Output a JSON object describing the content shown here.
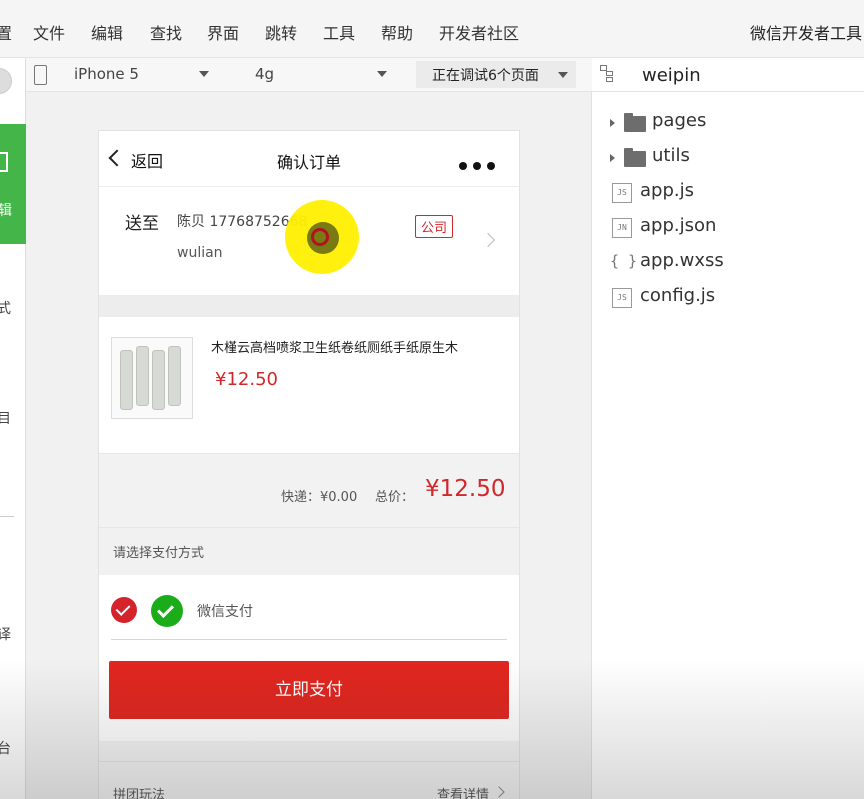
{
  "menubar": {
    "items": [
      "置",
      "文件",
      "编辑",
      "查找",
      "界面",
      "跳转",
      "工具",
      "帮助",
      "开发者社区"
    ],
    "app_title": "微信开发者工具"
  },
  "sidebar_strip": {
    "green_label": "辑",
    "texts": [
      "式",
      "目",
      "译",
      "台"
    ]
  },
  "device_bar": {
    "device": "iPhone 5",
    "network": "4g",
    "debug_status": "正在调试6个页面"
  },
  "phone": {
    "nav": {
      "back_label": "返回",
      "title": "确认订单"
    },
    "address": {
      "ship_to_label": "送至",
      "recipient": "陈贝 17768752668",
      "address_line": "wulian",
      "tag": "公司"
    },
    "product": {
      "name": "木槿云高档喷浆卫生纸卷纸厕纸手纸原生木",
      "price": "¥12.50"
    },
    "summary": {
      "shipping": "快递：¥0.00",
      "total_label": "总价：",
      "total": "¥12.50"
    },
    "payment": {
      "header": "请选择支付方式",
      "method": "微信支付",
      "pay_button": "立即支付"
    },
    "group": {
      "label": "拼团玩法",
      "link": "查看详情"
    }
  },
  "file_panel": {
    "project": "weipin",
    "entries": [
      {
        "type": "folder",
        "name": "pages"
      },
      {
        "type": "folder",
        "name": "utils"
      },
      {
        "type": "file",
        "badge": "JS",
        "name": "app.js"
      },
      {
        "type": "file",
        "badge": "JN",
        "name": "app.json"
      },
      {
        "type": "style",
        "badge": "{ }",
        "name": "app.wxss"
      },
      {
        "type": "file",
        "badge": "JS",
        "name": "config.js"
      }
    ]
  }
}
